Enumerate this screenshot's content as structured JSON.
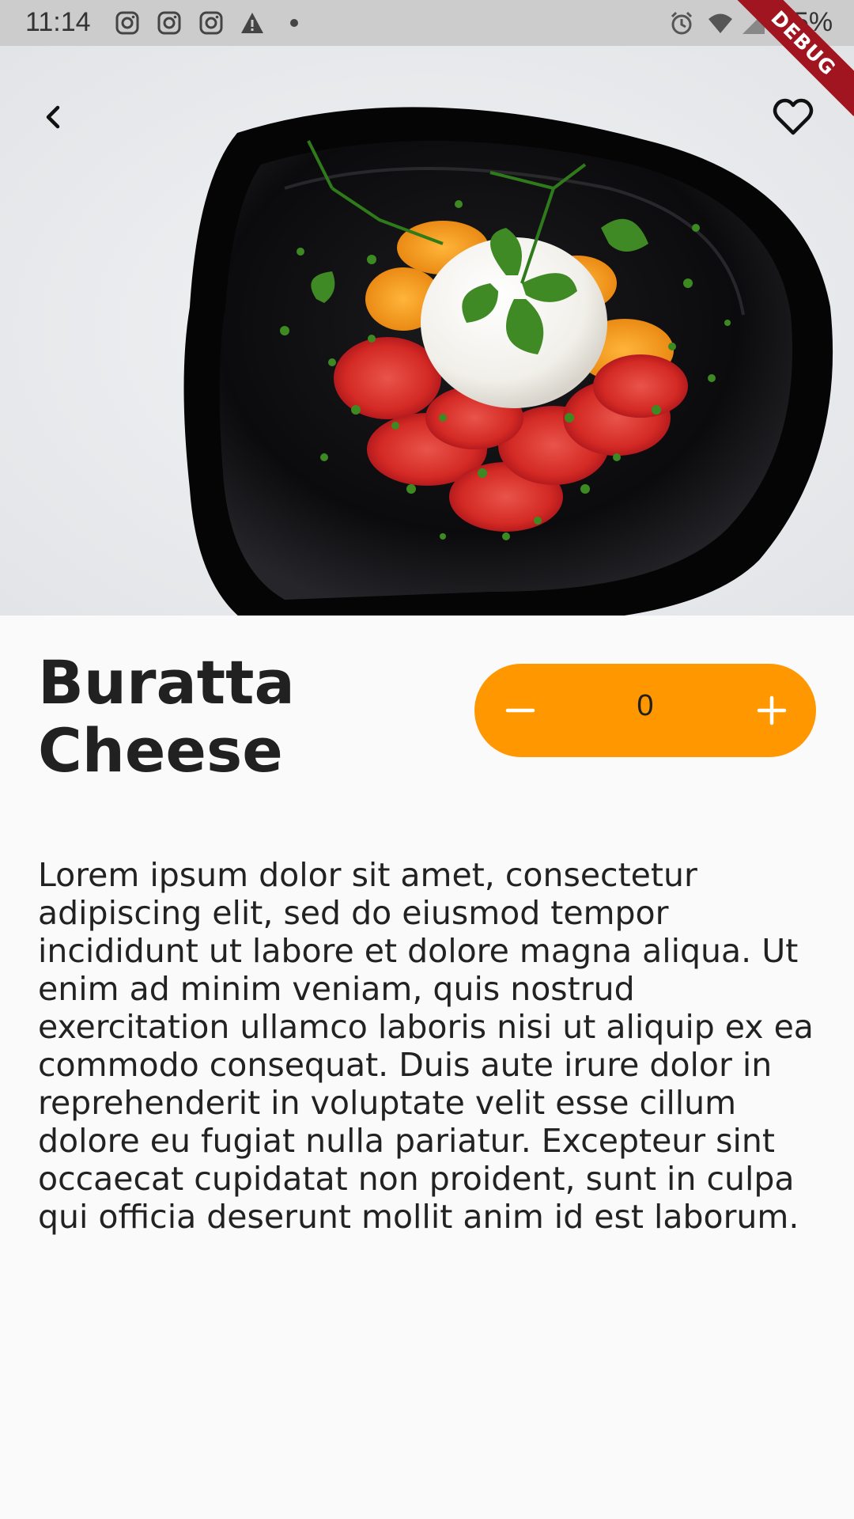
{
  "status_bar": {
    "time": "11:14",
    "battery": "65%",
    "notification_icons": [
      "instagram-icon",
      "instagram-icon",
      "instagram-icon",
      "warning-icon"
    ],
    "system_icons": [
      "alarm-icon",
      "wifi-icon",
      "signal-icon"
    ]
  },
  "debug_banner": "DEBUG",
  "header": {
    "back_icon": "chevron-left-icon",
    "favorite_icon": "heart-outline-icon"
  },
  "product": {
    "title": "Buratta Cheese",
    "description": "Lorem ipsum dolor sit amet, consectetur adipiscing elit, sed do eiusmod tempor incididunt ut labore et dolore magna aliqua. Ut enim ad minim veniam, quis nostrud exercitation ullamco laboris nisi ut aliquip ex ea commodo consequat. Duis aute irure dolor in reprehenderit in voluptate velit esse cillum dolore eu fugiat nulla pariatur. Excepteur sint occaecat cupidatat non proident, sunt in culpa qui officia deserunt mollit anim id est laborum."
  },
  "quantity": {
    "value": "0",
    "decrement_icon": "minus-icon",
    "increment_icon": "plus-icon"
  },
  "colors": {
    "accent": "#ff9800",
    "background": "#fafafa",
    "status_bar": "#cccccc",
    "debug_ribbon": "#a0151f"
  }
}
